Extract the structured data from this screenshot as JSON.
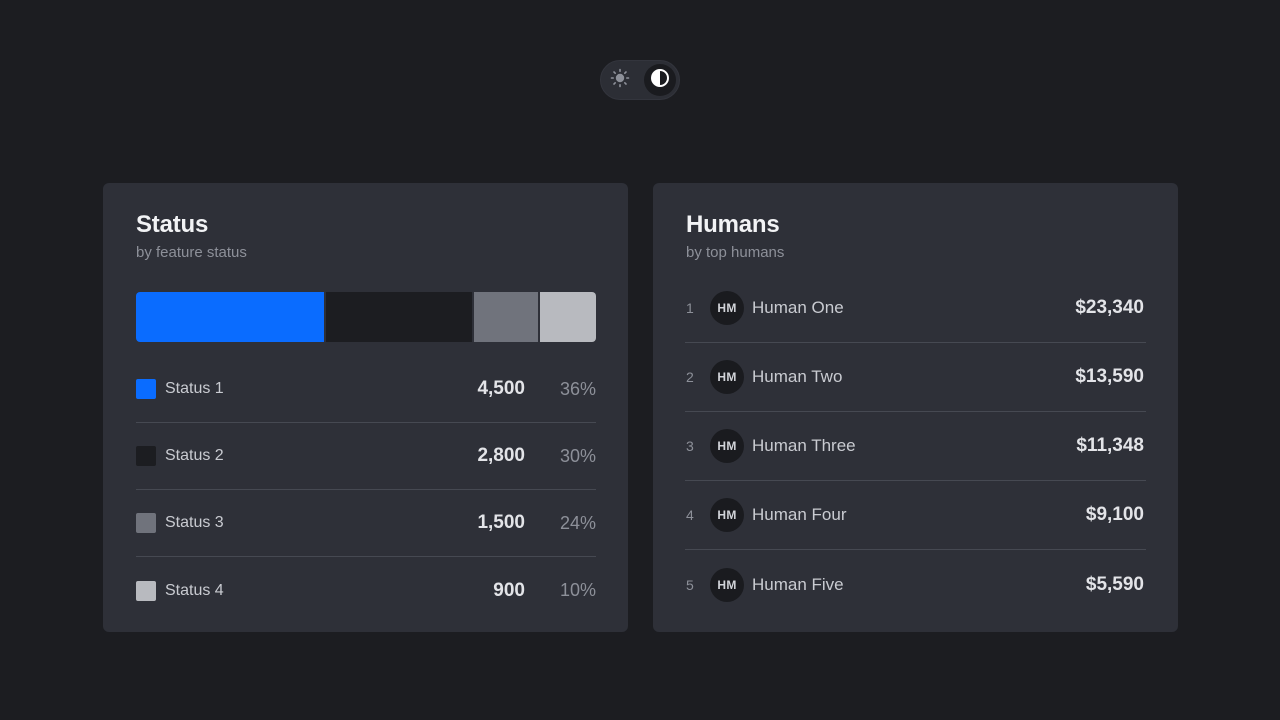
{
  "theme_toggle": {
    "icons": [
      "sun-icon",
      "contrast-icon"
    ],
    "active": "dark"
  },
  "status_card": {
    "title": "Status",
    "subtitle": "by feature status",
    "items": [
      {
        "label": "Status 1",
        "value": "4,500",
        "percent": "36%",
        "share": 0.36,
        "color": "#0a6cff"
      },
      {
        "label": "Status 2",
        "value": "2,800",
        "percent": "30%",
        "share": 0.3,
        "color": "#1c1d21"
      },
      {
        "label": "Status 3",
        "value": "1,500",
        "percent": "24%",
        "share": 0.24,
        "color": "#70737c"
      },
      {
        "label": "Status 4",
        "value": "900",
        "percent": "10%",
        "share": 0.1,
        "color": "#b8babf"
      }
    ]
  },
  "humans_card": {
    "title": "Humans",
    "subtitle": "by top humans",
    "items": [
      {
        "rank": "1",
        "initials": "HM",
        "name": "Human One",
        "amount": "$23,340"
      },
      {
        "rank": "2",
        "initials": "HM",
        "name": "Human Two",
        "amount": "$13,590"
      },
      {
        "rank": "3",
        "initials": "HM",
        "name": "Human Three",
        "amount": "$11,348"
      },
      {
        "rank": "4",
        "initials": "HM",
        "name": "Human Four",
        "amount": "$9,100"
      },
      {
        "rank": "5",
        "initials": "HM",
        "name": "Human Five",
        "amount": "$5,590"
      }
    ]
  }
}
